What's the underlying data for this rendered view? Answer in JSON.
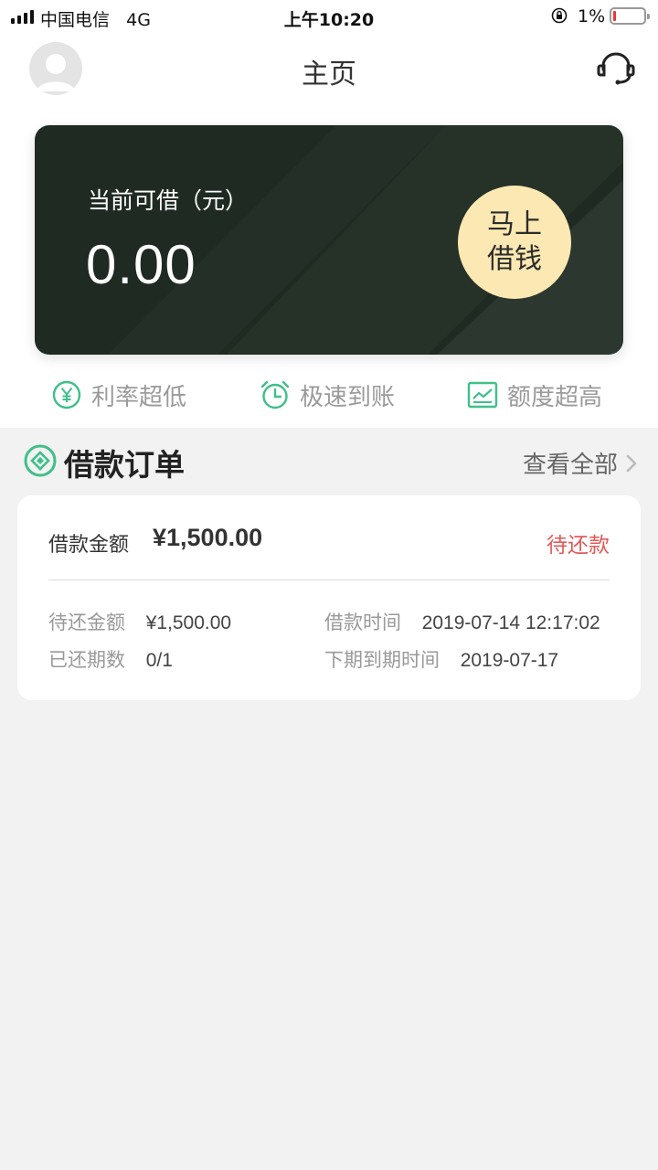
{
  "status_bar": {
    "carrier": "中国电信",
    "network": "4G",
    "time": "上午10:20",
    "battery_pct": "1%"
  },
  "header": {
    "title": "主页",
    "avatar_icon": "avatar-icon",
    "service_icon": "headset-icon"
  },
  "card": {
    "label": "当前可借（元）",
    "amount": "0.00",
    "button_line1": "马上",
    "button_line2": "借钱"
  },
  "features": [
    {
      "label": "利率超低",
      "icon": "yen-circle-icon"
    },
    {
      "label": "极速到账",
      "icon": "alarm-clock-icon"
    },
    {
      "label": "额度超高",
      "icon": "chart-icon"
    }
  ],
  "orders": {
    "title": "借款订单",
    "view_all": "查看全部",
    "item": {
      "amount_label": "借款金额",
      "amount": "¥1,500.00",
      "status": "待还款",
      "due_amount_label": "待还金额",
      "due_amount": "¥1,500.00",
      "loan_time_label": "借款时间",
      "loan_time": "2019-07-14 12:17:02",
      "periods_label": "已还期数",
      "periods": "0/1",
      "next_due_label": "下期到期时间",
      "next_due": "2019-07-17"
    }
  },
  "colors": {
    "card_bg": "#1f2b22",
    "accent_green": "#3fbf8a",
    "button_bg": "#fce8b2",
    "status_red": "#e05a5a"
  }
}
